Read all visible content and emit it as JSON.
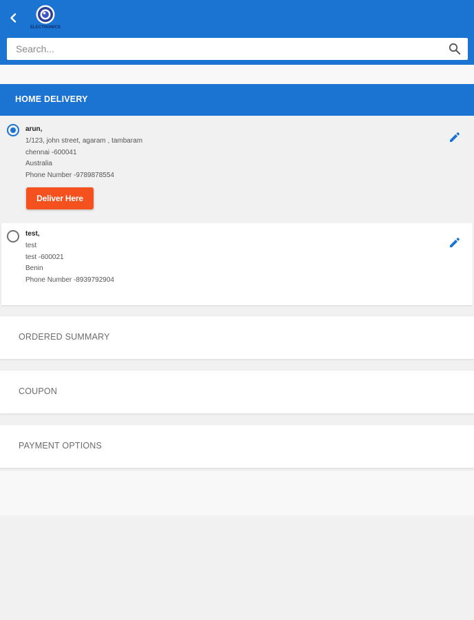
{
  "header": {
    "back_icon": "chevron-left-icon",
    "logo_text": "ELECTRONICS",
    "colors": {
      "primary": "#1b73d2"
    }
  },
  "search": {
    "placeholder": "Search...",
    "value": "",
    "icon": "search-icon"
  },
  "delivery": {
    "section_title": "HOME DELIVERY",
    "addresses": [
      {
        "name": "arun,",
        "line1": "1/123, john street, agaram , tambaram",
        "line2": "chennai -600041",
        "country": "Australia",
        "phone": "Phone Number -9789878554",
        "selected": true
      },
      {
        "name": "test,",
        "line1": "test",
        "line2": "test -600021",
        "country": "Benin",
        "phone": "Phone Number -8939792904",
        "selected": false
      }
    ],
    "deliver_button_label": "Deliver Here",
    "deliver_button_color": "#f4511e"
  },
  "panels": {
    "ordered_summary": "ORDERED SUMMARY",
    "coupon": "COUPON",
    "payment_options": "PAYMENT OPTIONS"
  }
}
